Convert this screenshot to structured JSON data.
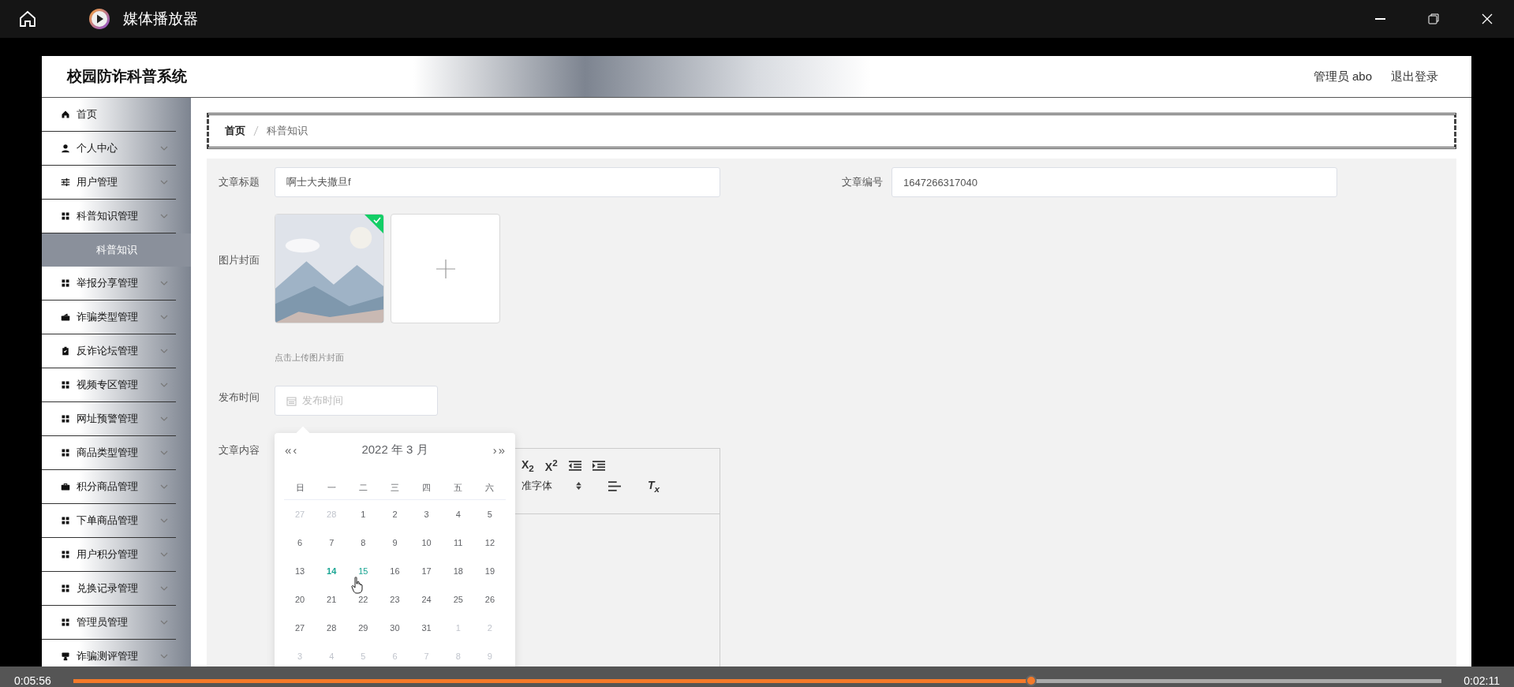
{
  "window": {
    "title": "媒体播放器"
  },
  "app": {
    "title": "校园防诈科普系统",
    "user": "管理员 abo",
    "logout": "退出登录"
  },
  "sidebar": {
    "items": [
      {
        "label": "首页",
        "kind": "home",
        "expandable": false,
        "selected": false
      },
      {
        "label": "个人中心",
        "kind": "user",
        "expandable": true,
        "selected": false
      },
      {
        "label": "用户管理",
        "kind": "sliders",
        "expandable": true,
        "selected": false
      },
      {
        "label": "科普知识管理",
        "kind": "grid",
        "expandable": true,
        "selected": false,
        "children": [
          {
            "label": "科普知识",
            "selected": true
          }
        ]
      },
      {
        "label": "举报分享管理",
        "kind": "grid",
        "expandable": true,
        "selected": false
      },
      {
        "label": "诈骗类型管理",
        "kind": "wallet",
        "expandable": true,
        "selected": false
      },
      {
        "label": "反诈论坛管理",
        "kind": "clipboard",
        "expandable": true,
        "selected": false
      },
      {
        "label": "视频专区管理",
        "kind": "grid",
        "expandable": true,
        "selected": false
      },
      {
        "label": "网址预警管理",
        "kind": "grid",
        "expandable": true,
        "selected": false
      },
      {
        "label": "商品类型管理",
        "kind": "grid",
        "expandable": true,
        "selected": false
      },
      {
        "label": "积分商品管理",
        "kind": "briefcase",
        "expandable": true,
        "selected": false
      },
      {
        "label": "下单商品管理",
        "kind": "grid",
        "expandable": true,
        "selected": false
      },
      {
        "label": "用户积分管理",
        "kind": "grid",
        "expandable": true,
        "selected": false
      },
      {
        "label": "兑换记录管理",
        "kind": "grid",
        "expandable": true,
        "selected": false
      },
      {
        "label": "管理员管理",
        "kind": "grid",
        "expandable": true,
        "selected": false
      },
      {
        "label": "诈骗测评管理",
        "kind": "stamp",
        "expandable": true,
        "selected": false
      }
    ]
  },
  "breadcrumb": [
    "首页",
    "科普知识"
  ],
  "form": {
    "title": {
      "label": "文章标题",
      "value": "啊士大夫撒旦f"
    },
    "number": {
      "label": "文章编号",
      "value": "1647266317040"
    },
    "cover": {
      "label": "图片封面",
      "items": [
        {
          "kind": "picture",
          "uploaded": true
        },
        {
          "kind": "add"
        }
      ],
      "hint": "点击上传图片封面"
    },
    "date": {
      "label": "发布时间",
      "placeholder": "发布时间"
    },
    "editor": {
      "label": "文章内容",
      "toolbar": [
        [
          {
            "kind": "text",
            "text": "X$_{2}$"
          },
          {
            "kind": "text",
            "text": "X$^{2}$"
          },
          {
            "kind": "outdent"
          },
          {
            "kind": "indent"
          }
        ],
        [
          {
            "kind": "select",
            "text": "准字体"
          },
          {
            "kind": "align"
          },
          {
            "kind": "clear",
            "text": "T$_{x}$"
          }
        ]
      ]
    }
  },
  "calendar": {
    "title": "2022 年  3 月",
    "prev_year": "«",
    "prev_month": "‹",
    "next_month": "›",
    "next_year": "»",
    "weekdays": [
      "日",
      "一",
      "二",
      "三",
      "四",
      "五",
      "六"
    ],
    "weeks": [
      [
        {
          "text": "27",
          "other_month": true,
          "today": false,
          "selected": false
        },
        {
          "text": "28",
          "other_month": true,
          "today": false,
          "selected": false
        },
        {
          "text": "1",
          "other_month": false,
          "today": false,
          "selected": false
        },
        {
          "text": "2",
          "other_month": false,
          "today": false,
          "selected": false
        },
        {
          "text": "3",
          "other_month": false,
          "today": false,
          "selected": false
        },
        {
          "text": "4",
          "other_month": false,
          "today": false,
          "selected": false
        },
        {
          "text": "5",
          "other_month": false,
          "today": false,
          "selected": false
        }
      ],
      [
        {
          "text": "6",
          "other_month": false,
          "today": false,
          "selected": false
        },
        {
          "text": "7",
          "other_month": false,
          "today": false,
          "selected": false
        },
        {
          "text": "8",
          "other_month": false,
          "today": false,
          "selected": false
        },
        {
          "text": "9",
          "other_month": false,
          "today": false,
          "selected": false
        },
        {
          "text": "10",
          "other_month": false,
          "today": false,
          "selected": false
        },
        {
          "text": "11",
          "other_month": false,
          "today": false,
          "selected": false
        },
        {
          "text": "12",
          "other_month": false,
          "today": false,
          "selected": false
        }
      ],
      [
        {
          "text": "13",
          "other_month": false,
          "today": false,
          "selected": false
        },
        {
          "text": "14",
          "other_month": false,
          "today": true,
          "selected": false
        },
        {
          "text": "15",
          "other_month": false,
          "today": false,
          "selected": true
        },
        {
          "text": "16",
          "other_month": false,
          "today": false,
          "selected": false
        },
        {
          "text": "17",
          "other_month": false,
          "today": false,
          "selected": false
        },
        {
          "text": "18",
          "other_month": false,
          "today": false,
          "selected": false
        },
        {
          "text": "19",
          "other_month": false,
          "today": false,
          "selected": false
        }
      ],
      [
        {
          "text": "20",
          "other_month": false,
          "today": false,
          "selected": false
        },
        {
          "text": "21",
          "other_month": false,
          "today": false,
          "selected": false
        },
        {
          "text": "22",
          "other_month": false,
          "today": false,
          "selected": false
        },
        {
          "text": "23",
          "other_month": false,
          "today": false,
          "selected": false
        },
        {
          "text": "24",
          "other_month": false,
          "today": false,
          "selected": false
        },
        {
          "text": "25",
          "other_month": false,
          "today": false,
          "selected": false
        },
        {
          "text": "26",
          "other_month": false,
          "today": false,
          "selected": false
        }
      ],
      [
        {
          "text": "27",
          "other_month": false,
          "today": false,
          "selected": false
        },
        {
          "text": "28",
          "other_month": false,
          "today": false,
          "selected": false
        },
        {
          "text": "29",
          "other_month": false,
          "today": false,
          "selected": false
        },
        {
          "text": "30",
          "other_month": false,
          "today": false,
          "selected": false
        },
        {
          "text": "31",
          "other_month": false,
          "today": false,
          "selected": false
        },
        {
          "text": "1",
          "other_month": true,
          "today": false,
          "selected": false
        },
        {
          "text": "2",
          "other_month": true,
          "today": false,
          "selected": false
        }
      ],
      [
        {
          "text": "3",
          "other_month": true,
          "today": false,
          "selected": false
        },
        {
          "text": "4",
          "other_month": true,
          "today": false,
          "selected": false
        },
        {
          "text": "5",
          "other_month": true,
          "today": false,
          "selected": false
        },
        {
          "text": "6",
          "other_month": true,
          "today": false,
          "selected": false
        },
        {
          "text": "7",
          "other_month": true,
          "today": false,
          "selected": false
        },
        {
          "text": "8",
          "other_month": true,
          "today": false,
          "selected": false
        },
        {
          "text": "9",
          "other_month": true,
          "today": false,
          "selected": false
        }
      ]
    ]
  },
  "player": {
    "elapsed": "0:05:56",
    "remaining": "0:02:11",
    "level": 0.7
  }
}
